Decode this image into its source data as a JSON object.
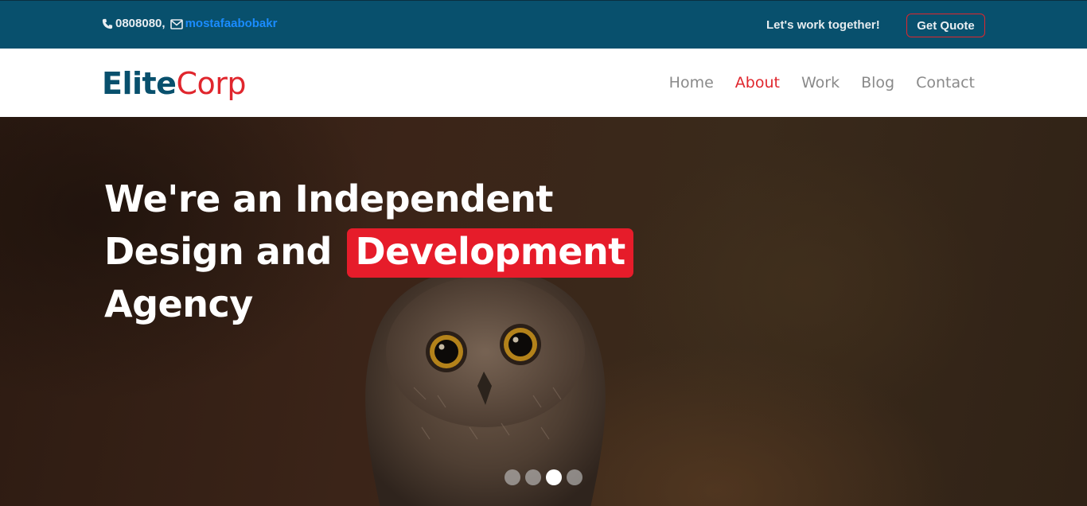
{
  "topbar": {
    "phone": "0808080,",
    "email": "mostafaabobakr",
    "tagline": "Let's work together!",
    "quote_label": "Get Quote",
    "icons": [
      "phone-icon",
      "envelope-icon"
    ]
  },
  "brand": {
    "part1": "Elite",
    "part2": "Corp",
    "colors": {
      "primary": "#08506d",
      "accent": "#e0262d"
    }
  },
  "nav": {
    "items": [
      {
        "label": "Home",
        "active": false
      },
      {
        "label": "About",
        "active": true
      },
      {
        "label": "Work",
        "active": false
      },
      {
        "label": "Blog",
        "active": false
      },
      {
        "label": "Contact",
        "active": false
      }
    ]
  },
  "hero": {
    "line1": "We're an Independent",
    "line2_prefix": "Design and",
    "line2_highlight": "Development",
    "line3": "Agency",
    "highlight_color": "#e61c2a",
    "slides_total": 4,
    "slide_active": 3
  }
}
